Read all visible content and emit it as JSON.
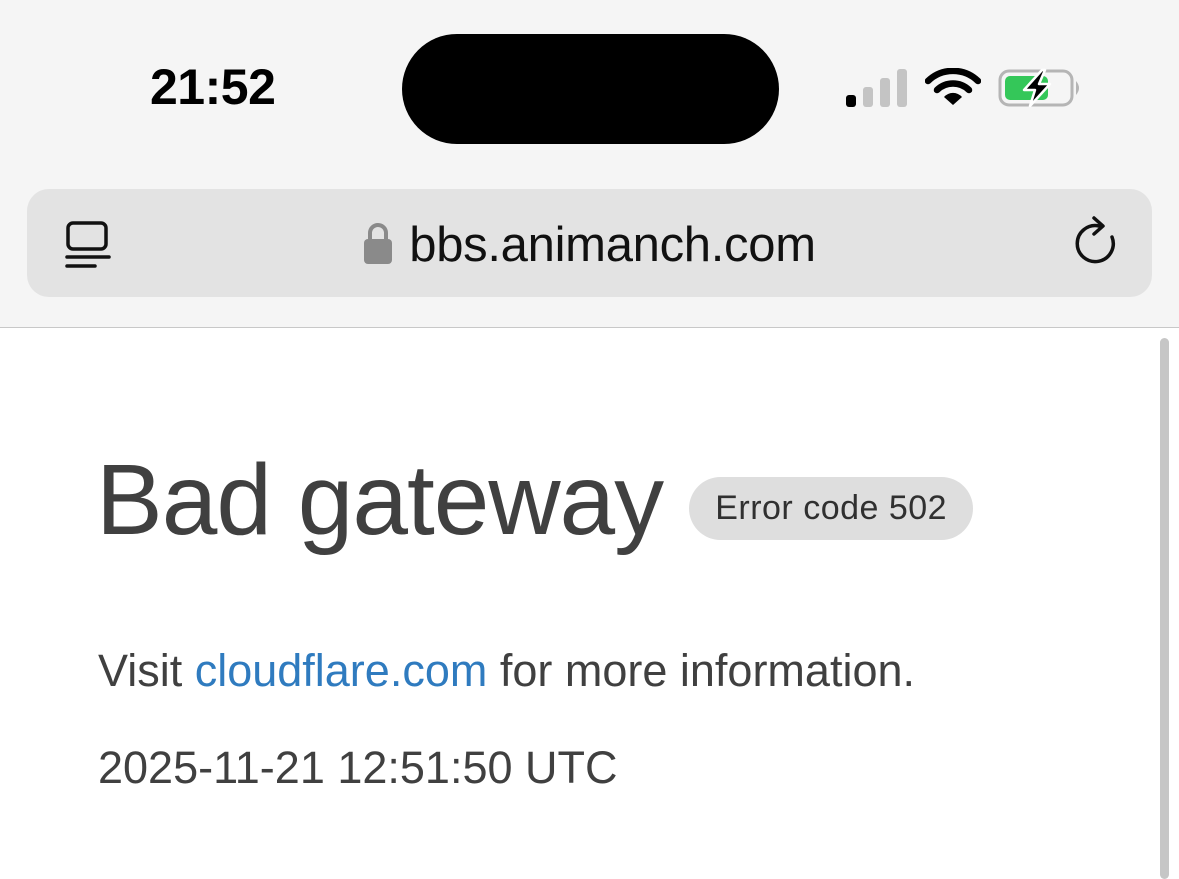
{
  "status_bar": {
    "time": "21:52",
    "signal_bars_active": 1,
    "signal_bars_total": 4,
    "battery_charging": true,
    "battery_level": 0.6,
    "battery_color": "#34c759"
  },
  "address_bar": {
    "url": "bbs.animanch.com",
    "left_icon": "reader-view-icon",
    "lock_icon": "lock-icon",
    "right_icon": "reload-icon"
  },
  "page": {
    "title": "Bad gateway",
    "error_badge": "Error code 502",
    "info_prefix": "Visit ",
    "info_link": "cloudflare.com",
    "info_suffix": " for more information.",
    "timestamp": "2025-11-21 12:51:50 UTC",
    "link_color": "#2f7bbf"
  }
}
